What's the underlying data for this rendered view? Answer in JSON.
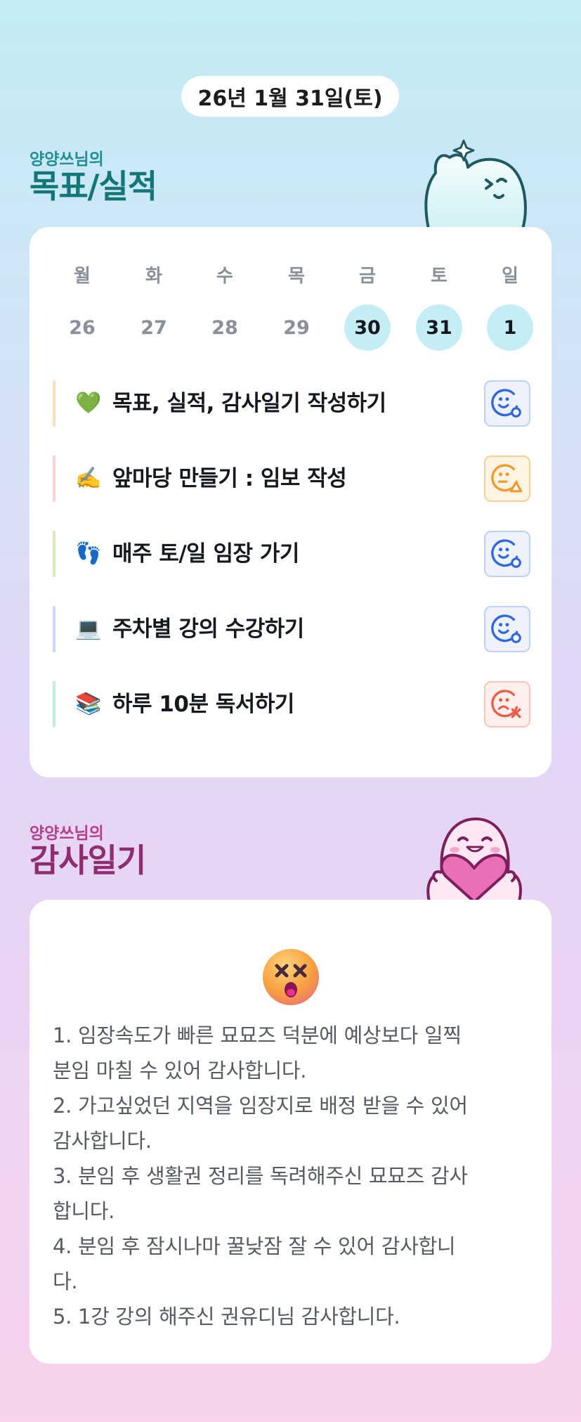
{
  "date_label": "26년 1월 31일(토)",
  "goal_section": {
    "owner_label": "양양쓰님의",
    "title": "목표/실적"
  },
  "week": {
    "day_names": [
      "월",
      "화",
      "수",
      "목",
      "금",
      "토",
      "일"
    ],
    "dates": [
      "26",
      "27",
      "28",
      "29",
      "30",
      "31",
      "1"
    ],
    "highlighted": [
      false,
      false,
      false,
      false,
      true,
      true,
      true
    ]
  },
  "goals": [
    {
      "emoji": "💚",
      "label": "목표, 실적, 감사일기 작성하기",
      "status": "done",
      "bar_color": "#fbe1bd"
    },
    {
      "emoji": "✍️",
      "label": "앞마당 만들기 : 임보 작성",
      "status": "partial",
      "bar_color": "#fbd3d0"
    },
    {
      "emoji": "👣",
      "label": "매주 토/일 임장 가기",
      "status": "done",
      "bar_color": "#d2eeb6"
    },
    {
      "emoji": "💻",
      "label": "주차별 강의 수강하기",
      "status": "done",
      "bar_color": "#c9dbf6"
    },
    {
      "emoji": "📚",
      "label": "하루 10분 독서하기",
      "status": "fail",
      "bar_color": "#c2ecdc"
    }
  ],
  "gratitude_section": {
    "owner_label": "양양쓰님의",
    "title": "감사일기"
  },
  "gratitude_icon": "dizzy-face-icon",
  "gratitude_lines": [
    "1. 임장속도가 빠른 묘묘즈 덕분에 예상보다 일찍",
    "분임 마칠 수 있어 감사합니다.",
    "2. 가고싶었던 지역을 임장지로 배정 받을 수 있어",
    "감사합니다.",
    "3. 분임 후 생활권 정리를 독려해주신 묘묘즈 감사",
    "합니다.",
    "4. 분임 후 잠시나마 꿀낮잠 잘 수 있어 감사합니",
    "다.",
    "5. 1강 강의 해주신 권유디님 감사합니다."
  ],
  "colors": {
    "goal_title": "#13777a",
    "gratitude_title": "#8f2d6f",
    "day_active_bg": "#c4eef4",
    "status_done": "#2f67dd",
    "status_partial": "#ee9a2c",
    "status_fail": "#ec5c4a"
  }
}
